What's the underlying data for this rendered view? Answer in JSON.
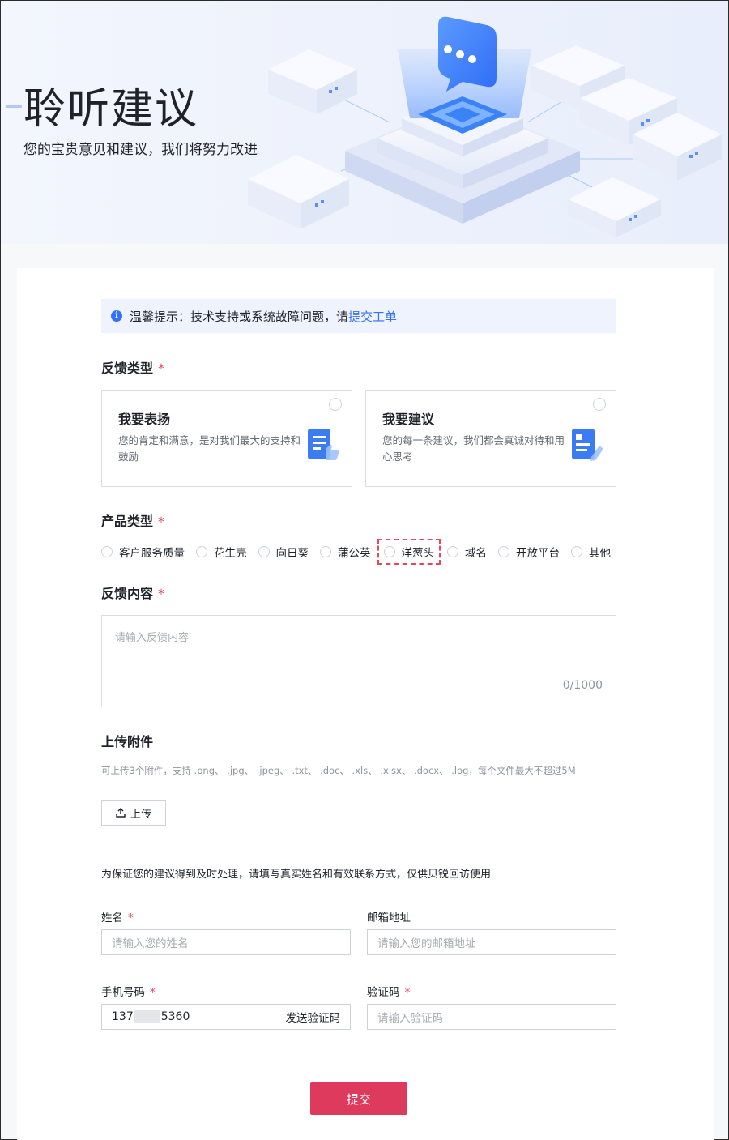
{
  "hero": {
    "title": "聆听建议",
    "subtitle": "您的宝贵意见和建议，我们将努力改进"
  },
  "tip": {
    "text": "温馨提示：技术支持或系统故障问题，请",
    "link": "提交工单"
  },
  "feedback_type": {
    "label": "反馈类型",
    "required_mark": "*",
    "options": [
      {
        "title": "我要表扬",
        "desc": "您的肯定和满意，是对我们最大的支持和鼓励"
      },
      {
        "title": "我要建议",
        "desc": "您的每一条建议，我们都会真诚对待和用心思考"
      }
    ]
  },
  "product_type": {
    "label": "产品类型",
    "required_mark": "*",
    "options": [
      "客户服务质量",
      "花生壳",
      "向日葵",
      "蒲公英",
      "洋葱头",
      "域名",
      "开放平台",
      "其他"
    ],
    "focused": "洋葱头"
  },
  "content": {
    "label": "反馈内容",
    "required_mark": "*",
    "placeholder": "请输入反馈内容",
    "counter": "0/1000"
  },
  "upload": {
    "label": "上传附件",
    "hint": "可上传3个附件，支持 .png、 .jpg、 .jpeg、 .txt、 .doc、 .xls、 .xlsx、 .docx、 .log，每个文件最大不超过5M",
    "button": "上传"
  },
  "contact": {
    "note": "为保证您的建议得到及时处理，请填写真实姓名和有效联系方式，仅供贝锐回访使用",
    "name_label": "姓名",
    "name_placeholder": "请输入您的姓名",
    "email_label": "邮箱地址",
    "email_placeholder": "请输入您的邮箱地址",
    "phone_label": "手机号码",
    "phone_prefix": "137",
    "phone_suffix": "5360",
    "send_code": "发送验证码",
    "code_label": "验证码",
    "code_placeholder": "请输入验证码",
    "required_mark": "*"
  },
  "submit": "提交",
  "colors": {
    "accent": "#3370ff",
    "required": "#e5475f",
    "submit": "#de3a5d"
  }
}
